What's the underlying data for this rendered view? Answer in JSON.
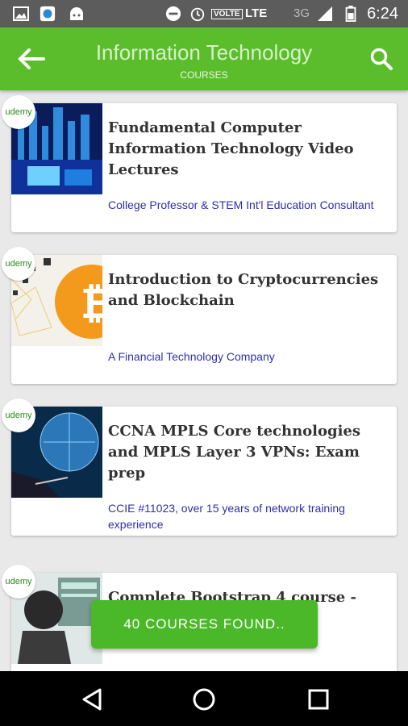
{
  "status_bar": {
    "icons": [
      "image-icon",
      "app-icon",
      "android-icon",
      "dnd-icon",
      "alarm-icon",
      "volte-icon",
      "signal-icon",
      "battery-icon"
    ],
    "volte": "VOLTE",
    "lte": "LTE",
    "network": "3G",
    "time": "6:24"
  },
  "app_bar": {
    "title": "Information Technology",
    "subtitle": "COURSES",
    "colors": {
      "bar": "#5bbd2c"
    }
  },
  "courses": [
    {
      "badge": "udemy",
      "title": "Fundamental Computer Information Technology Video Lectures",
      "author": "College Professor & STEM Int'l Education Consultant"
    },
    {
      "badge": "udemy",
      "title": "Introduction to Cryptocurrencies and Blockchain",
      "author": "A Financial Technology Company"
    },
    {
      "badge": "udemy",
      "title": "CCNA MPLS Core technologies and MPLS Layer 3 VPNs: Exam prep",
      "author": "CCIE #11023, over 15 years of network training experience"
    },
    {
      "badge": "udemy",
      "title": "Complete Bootstrap 4 course - build 3",
      "author": ""
    }
  ],
  "snackbar": {
    "label": "40 COURSES FOUND.."
  },
  "nav": [
    "back-triangle-icon",
    "home-circle-icon",
    "recents-square-icon"
  ]
}
